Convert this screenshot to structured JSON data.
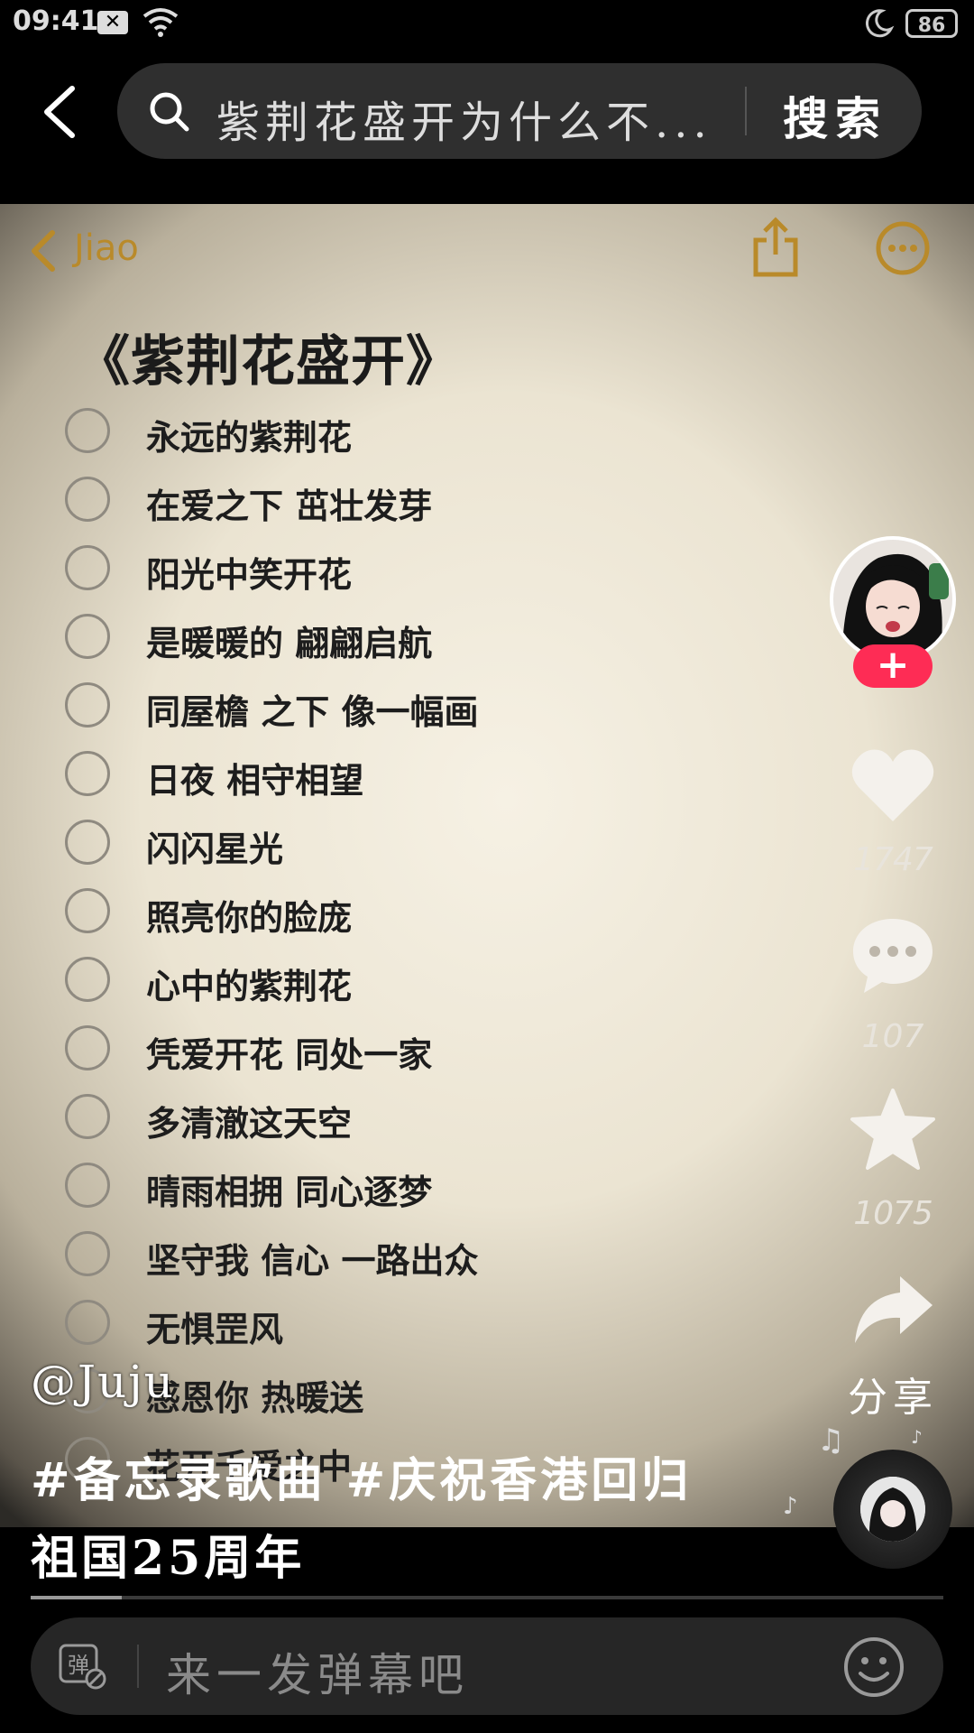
{
  "status_bar": {
    "time": "09:41",
    "battery": "86"
  },
  "search": {
    "query": "紫荆花盛开为什么不...",
    "button_label": "搜索"
  },
  "notes": {
    "back_label": "Jiao",
    "title": "《紫荆花盛开》",
    "items": [
      "永远的紫荆花",
      "在爱之下 茁壮发芽",
      "阳光中笑开花",
      "是暖暖的 翩翩启航",
      "同屋檐 之下 像一幅画",
      "日夜 相守相望",
      "闪闪星光",
      "照亮你的脸庞",
      "心中的紫荆花",
      "凭爱开花 同处一家",
      "多清澈这天空",
      "晴雨相拥 同心逐梦",
      "坚守我 信心 一路出众",
      "无惧罡风",
      "感恩你 热暖送",
      "花开千爱之中"
    ]
  },
  "sidebar": {
    "like_count": "1747",
    "comment_count": "107",
    "favorite_count": "1075",
    "share_label": "分享"
  },
  "caption": {
    "author": "@Juju",
    "line1": "#备忘录歌曲 #庆祝香港回归",
    "line2": "祖国25周年"
  },
  "progress": {
    "fraction": 0.1
  },
  "danmaku": {
    "toggle_label": "弹",
    "placeholder": "来一发弹幕吧"
  },
  "colors": {
    "accent": "#fe2c55",
    "notes_accent": "#b98a2a"
  }
}
